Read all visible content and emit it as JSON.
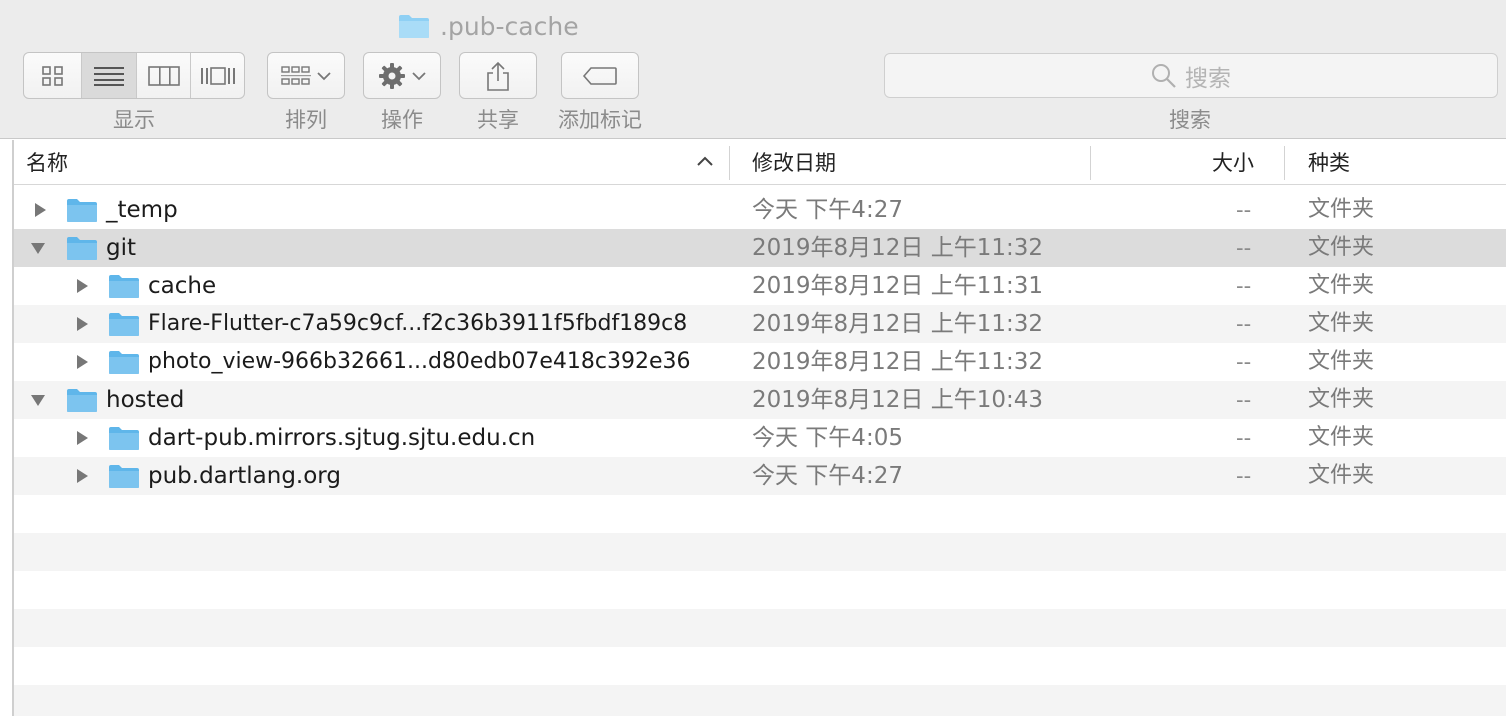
{
  "window": {
    "title": ".pub-cache",
    "folder_icon": "folder-icon"
  },
  "toolbar": {
    "view_label": "显示",
    "view_modes": [
      "icon-view-icon",
      "list-view-icon",
      "column-view-icon",
      "gallery-view-icon"
    ],
    "arrange_label": "排列",
    "action_label": "操作",
    "share_label": "共享",
    "tags_label": "添加标记",
    "search_placeholder": "搜索",
    "search_label": "搜索"
  },
  "columns": {
    "name": "名称",
    "date": "修改日期",
    "size": "大小",
    "kind": "种类"
  },
  "rows": [
    {
      "name": "_temp",
      "date": "今天 下午4:27",
      "size": "--",
      "kind": "文件夹",
      "expanded": false,
      "depth": 0
    },
    {
      "name": "git",
      "date": "2019年8月12日 上午11:32",
      "size": "--",
      "kind": "文件夹",
      "expanded": true,
      "depth": 0,
      "selected": true
    },
    {
      "name": "cache",
      "date": "2019年8月12日 上午11:31",
      "size": "--",
      "kind": "文件夹",
      "expanded": false,
      "depth": 1
    },
    {
      "name": "Flare-Flutter-c7a59c9cf...f2c36b3911f5fbdf189c8",
      "date": "2019年8月12日 上午11:32",
      "size": "--",
      "kind": "文件夹",
      "expanded": false,
      "depth": 1
    },
    {
      "name": "photo_view-966b32661...d80edb07e418c392e36",
      "date": "2019年8月12日 上午11:32",
      "size": "--",
      "kind": "文件夹",
      "expanded": false,
      "depth": 1
    },
    {
      "name": "hosted",
      "date": "2019年8月12日 上午10:43",
      "size": "--",
      "kind": "文件夹",
      "expanded": true,
      "depth": 0
    },
    {
      "name": "dart-pub.mirrors.sjtug.sjtu.edu.cn",
      "date": "今天 下午4:05",
      "size": "--",
      "kind": "文件夹",
      "expanded": false,
      "depth": 1
    },
    {
      "name": "pub.dartlang.org",
      "date": "今天 下午4:27",
      "size": "--",
      "kind": "文件夹",
      "expanded": false,
      "depth": 1
    }
  ],
  "colors": {
    "folder": "#7cc4ef",
    "selection": "#dcdcdc",
    "stripe": "#f4f4f4"
  }
}
